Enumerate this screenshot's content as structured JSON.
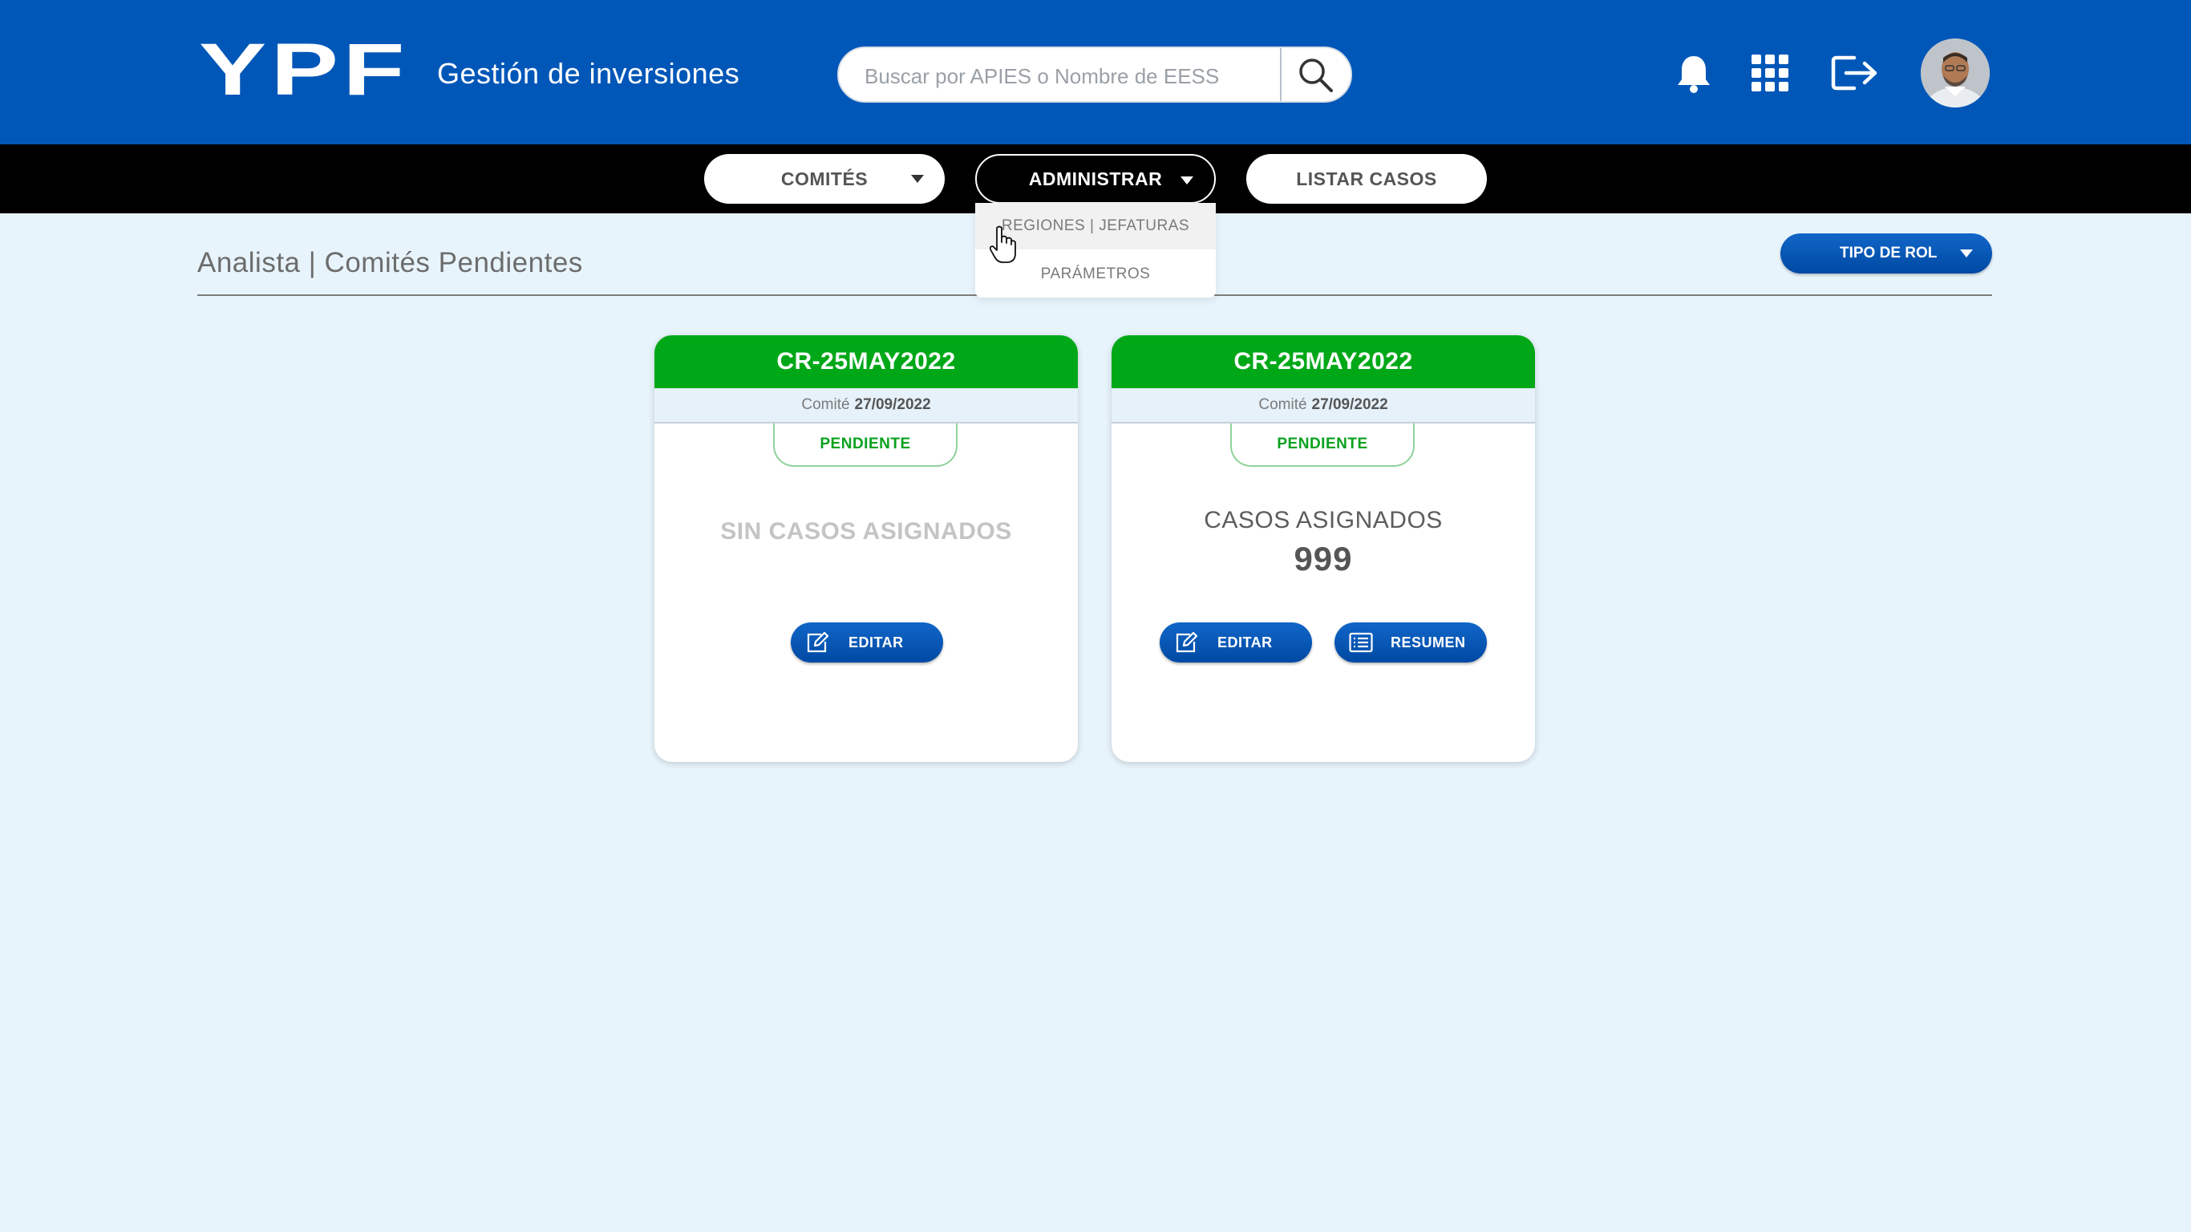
{
  "header": {
    "logo_text": "YPF",
    "app_title": "Gestión de inversiones",
    "search": {
      "placeholder": "Buscar por APIES o Nombre de EESS",
      "value": ""
    },
    "icons": [
      "bell-icon",
      "apps-grid-icon",
      "logout-icon"
    ],
    "brand_color": "#0057b8"
  },
  "nav": {
    "items": [
      {
        "label": "COMITÉS",
        "has_dropdown": true,
        "active": false
      },
      {
        "label": "ADMINISTRAR",
        "has_dropdown": true,
        "active": true
      },
      {
        "label": "LISTAR CASOS",
        "has_dropdown": false,
        "active": false
      }
    ],
    "dropdown": {
      "items": [
        {
          "label": "REGIONES | JEFATURAS",
          "hovered": true
        },
        {
          "label": "PARÁMETROS",
          "hovered": false
        }
      ]
    }
  },
  "page": {
    "title": "Analista | Comités Pendientes",
    "role_button": "TIPO DE ROL"
  },
  "cards": [
    {
      "code": "CR-25MAY2022",
      "committee_label": "Comité",
      "committee_date": "27/09/2022",
      "status": "PENDIENTE",
      "empty_message": "SIN CASOS ASIGNADOS",
      "buttons": [
        {
          "label": "EDITAR",
          "icon": "edit-icon"
        }
      ]
    },
    {
      "code": "CR-25MAY2022",
      "committee_label": "Comité",
      "committee_date": "27/09/2022",
      "status": "PENDIENTE",
      "cases_label": "CASOS ASIGNADOS",
      "cases_count": "999",
      "buttons": [
        {
          "label": "EDITAR",
          "icon": "edit-icon"
        },
        {
          "label": "RESUMEN",
          "icon": "list-icon"
        }
      ]
    }
  ],
  "colors": {
    "header_blue": "#0057b8",
    "nav_black": "#000000",
    "page_bg": "#e8f4fc",
    "card_header_green": "#00a818",
    "status_green": "#0aa11f",
    "button_blue": "#0b5cbd"
  }
}
